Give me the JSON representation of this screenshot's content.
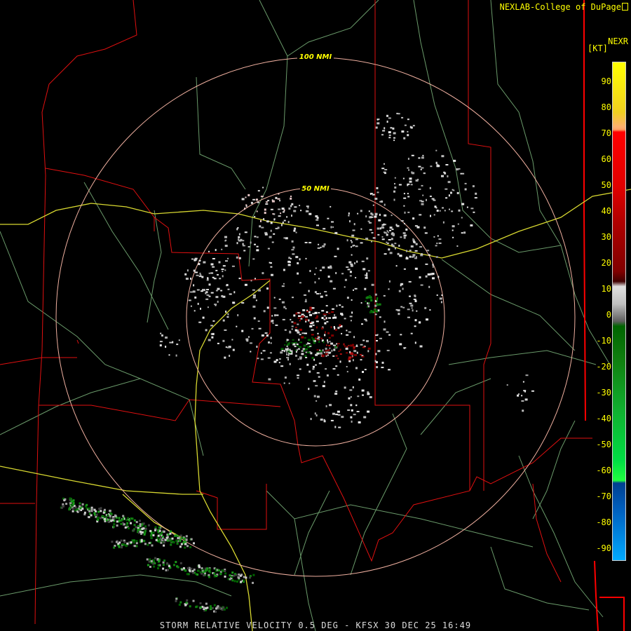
{
  "credit": "NEXLAB-College of DuPage",
  "product": "NEXR",
  "legend": {
    "unit": "[KT]",
    "ticks": [
      "90",
      "80",
      "70",
      "60",
      "50",
      "40",
      "30",
      "20",
      "10",
      "0",
      "-10",
      "-20",
      "-30",
      "-40",
      "-50",
      "-60",
      "-70",
      "-80",
      "-90"
    ],
    "colors": {
      "positive_high": "#ffff00",
      "positive_mid": "#ff0000",
      "positive_low": "#800000",
      "zero": "#c0c0c0",
      "negative_low": "#006400",
      "negative_mid": "#00dd44",
      "negative_high": "#00aaff"
    }
  },
  "range_rings": [
    "100 NMI",
    "50 NMI"
  ],
  "footer": "STORM RELATIVE VELOCITY 0.5 DEG - KFSX 30 DEC 25 16:49",
  "overlay_colors": {
    "ring": "#f0b0a0",
    "county_border": "#ff0000",
    "highway": "#ffff00",
    "road": "#80c080",
    "state_border": "#ff0000"
  }
}
